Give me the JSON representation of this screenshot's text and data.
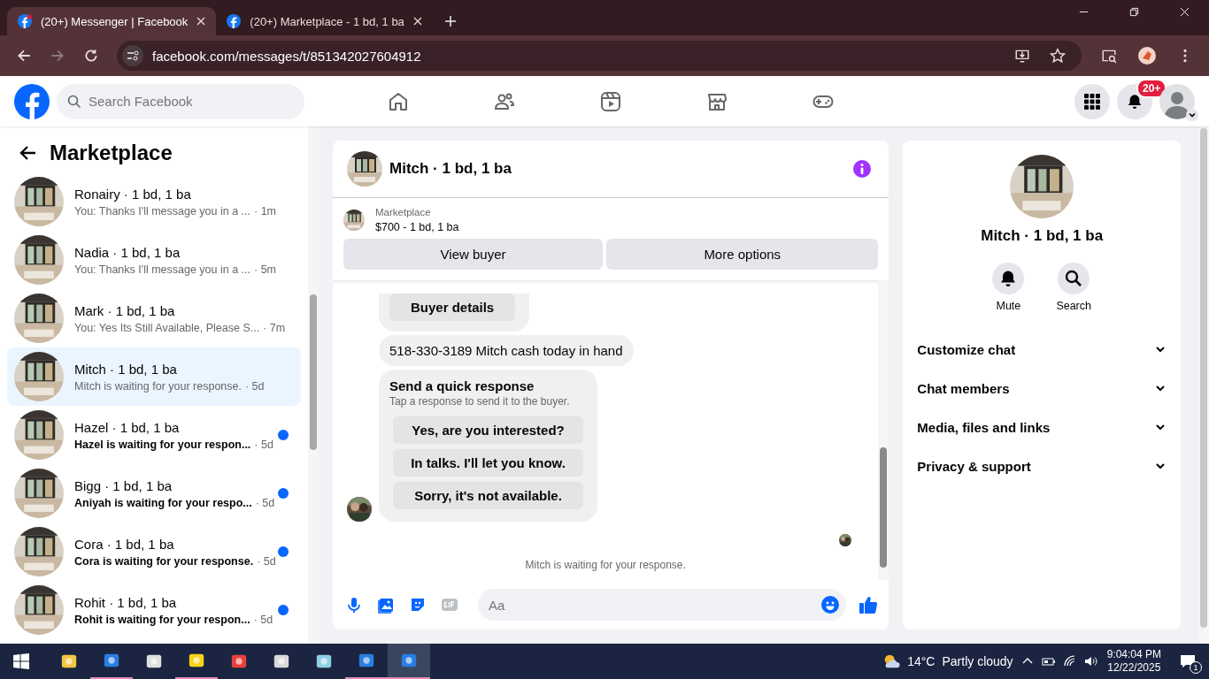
{
  "browser": {
    "tabs": [
      {
        "title": "(20+) Messenger | Facebook",
        "selected": true,
        "notification": true
      },
      {
        "title": "(20+) Marketplace - 1 bd, 1 ba",
        "selected": false,
        "notification": false
      }
    ],
    "url": "facebook.com/messages/t/851342027604912"
  },
  "header": {
    "search": {
      "placeholder": "Search Facebook"
    },
    "notifications_badge": "20+"
  },
  "sidebar": {
    "title": "Marketplace",
    "conversations": [
      {
        "name": "Ronairy · 1 bd, 1 ba",
        "preview": "You: Thanks I'll message you in a ...",
        "time": "· 1m",
        "selected": false,
        "unread": false
      },
      {
        "name": "Nadia · 1 bd, 1 ba",
        "preview": "You: Thanks I'll message you in a ...",
        "time": "· 5m",
        "selected": false,
        "unread": false
      },
      {
        "name": "Mark · 1 bd, 1 ba",
        "preview": "You: Yes Its Still Available, Please S...",
        "time": "· 7m",
        "selected": false,
        "unread": false
      },
      {
        "name": "Mitch · 1 bd, 1 ba",
        "preview": "Mitch is waiting for your response.",
        "time": "· 5d",
        "selected": true,
        "unread": false
      },
      {
        "name": "Hazel · 1 bd, 1 ba",
        "preview": "Hazel is waiting for your respon...",
        "time": "· 5d",
        "selected": false,
        "unread": true
      },
      {
        "name": "Bigg · 1 bd, 1 ba",
        "preview": "Aniyah is waiting for your respo...",
        "time": "· 5d",
        "selected": false,
        "unread": true
      },
      {
        "name": "Cora · 1 bd, 1 ba",
        "preview": "Cora is waiting for your response.",
        "time": "· 5d",
        "selected": false,
        "unread": true
      },
      {
        "name": "Rohit · 1 bd, 1 ba",
        "preview": "Rohit is waiting for your respon...",
        "time": "· 5d",
        "selected": false,
        "unread": true
      }
    ]
  },
  "chat": {
    "title": "Mitch · 1 bd, 1 ba",
    "listing": {
      "label": "Marketplace",
      "title": "$700 - 1 bd, 1 ba",
      "buttons": [
        "View buyer",
        "More options"
      ]
    },
    "messages": [
      {
        "kind": "button",
        "text": "Buyer details"
      },
      {
        "kind": "text",
        "text": "518-330-3189 Mitch cash today in hand"
      },
      {
        "kind": "quick",
        "title": "Send a quick response",
        "subtitle": "Tap a response to send it to the buyer.",
        "options": [
          "Yes, are you interested?",
          "In talks. I'll let you know.",
          "Sorry, it's not available."
        ]
      }
    ],
    "status": "Mitch is waiting for your response.",
    "composer": {
      "placeholder": "Aa"
    }
  },
  "details": {
    "name": "Mitch · 1 bd, 1 ba",
    "actions": [
      {
        "kind": "mute",
        "label": "Mute"
      },
      {
        "kind": "search",
        "label": "Search"
      }
    ],
    "sections": [
      "Customize chat",
      "Chat members",
      "Media, files and links",
      "Privacy & support"
    ]
  },
  "taskbar": {
    "temperature": "14°C",
    "weather": "Partly cloudy",
    "time": "9:04:04 PM",
    "date": "12/22/2025",
    "notifications": "1"
  }
}
